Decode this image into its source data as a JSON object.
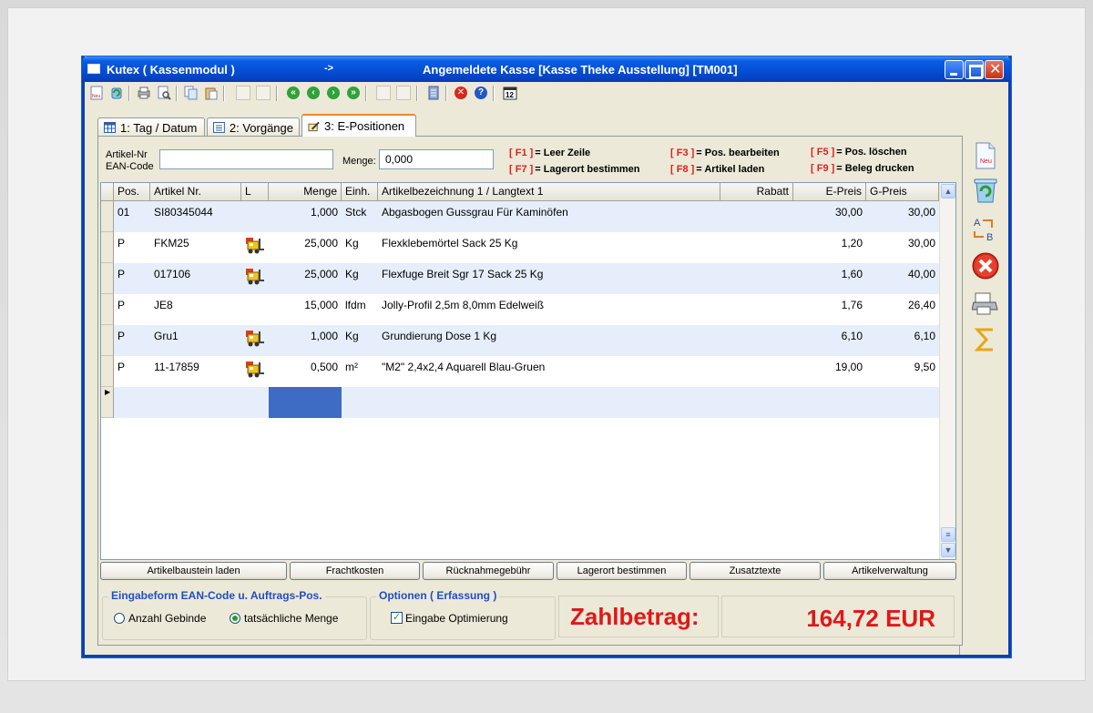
{
  "window": {
    "app_title": "Kutex ( Kassenmodul )",
    "arrow": "->",
    "kasse": "Angemeldete Kasse [Kasse Theke Ausstellung] [TM001]"
  },
  "toolbar": {
    "new_label": "Neu",
    "calendar_label": "12",
    "icons": [
      "new-doc-icon",
      "refresh-icon",
      "print-icon",
      "print-preview-icon",
      "copy-icon",
      "paste-icon",
      "first-icon",
      "prev-icon",
      "next-icon",
      "last-icon",
      "notes-icon",
      "cancel-icon",
      "help-icon",
      "calendar-icon"
    ]
  },
  "tabs": [
    {
      "label": "1: Tag / Datum"
    },
    {
      "label": "2: Vorgänge"
    },
    {
      "label": "3: E-Positionen"
    }
  ],
  "form": {
    "artikel_label_1": "Artikel-Nr",
    "artikel_label_2": "EAN-Code",
    "artikel_value": "",
    "menge_label": "Menge:",
    "menge_value": "0,000"
  },
  "hotkeys": [
    {
      "key": "[ F1 ]",
      "text": "= Leer Zeile"
    },
    {
      "key": "[ F7 ]",
      "text": "= Lagerort bestimmen"
    },
    {
      "key": "[ F3 ]",
      "text": "= Pos. bearbeiten"
    },
    {
      "key": "[ F8 ]",
      "text": "= Artikel laden"
    },
    {
      "key": "[ F5 ]",
      "text": "= Pos. löschen"
    },
    {
      "key": "[ F9 ]",
      "text": "= Beleg drucken"
    }
  ],
  "table": {
    "columns": [
      "Pos.",
      "Artikel Nr.",
      "L",
      "Menge",
      "Einh.",
      "Artikelbezeichnung 1 / Langtext 1",
      "Rabatt",
      "E-Preis",
      "G-Preis"
    ],
    "rows": [
      {
        "pos": "01",
        "artikel": "SI80345044",
        "lager": false,
        "menge": "1,000",
        "einh": "Stck",
        "bez": "Abgasbogen Gussgrau Für Kaminöfen",
        "rabatt": "",
        "epreis": "30,00",
        "gpreis": "30,00"
      },
      {
        "pos": "P",
        "artikel": "FKM25",
        "lager": true,
        "menge": "25,000",
        "einh": "Kg",
        "bez": "Flexklebemörtel Sack 25 Kg",
        "rabatt": "",
        "epreis": "1,20",
        "gpreis": "30,00"
      },
      {
        "pos": "P",
        "artikel": "017106",
        "lager": true,
        "menge": "25,000",
        "einh": "Kg",
        "bez": "Flexfuge Breit Sgr 17 Sack 25 Kg",
        "rabatt": "",
        "epreis": "1,60",
        "gpreis": "40,00"
      },
      {
        "pos": "P",
        "artikel": "JE8",
        "lager": false,
        "menge": "15,000",
        "einh": "lfdm",
        "bez": "Jolly-Profil 2,5m 8,0mm Edelweiß",
        "rabatt": "",
        "epreis": "1,76",
        "gpreis": "26,40"
      },
      {
        "pos": "P",
        "artikel": "Gru1",
        "lager": true,
        "menge": "1,000",
        "einh": "Kg",
        "bez": "Grundierung Dose 1 Kg",
        "rabatt": "",
        "epreis": "6,10",
        "gpreis": "6,10"
      },
      {
        "pos": "P",
        "artikel": "11-17859",
        "lager": true,
        "menge": "0,500",
        "einh": "m²",
        "bez": "\"M2\" 2,4x2,4 Aquarell Blau-Gruen",
        "rabatt": "",
        "epreis": "19,00",
        "gpreis": "9,50"
      }
    ]
  },
  "buttons": [
    "Artikelbaustein laden",
    "Frachtkosten",
    "Rücknahmegebühr",
    "Lagerort bestimmen",
    "Zusatztexte",
    "Artikelverwaltung"
  ],
  "eingabeform": {
    "title": "Eingabeform EAN-Code  u.  Auftrags-Pos.",
    "option1": "Anzahl Gebinde",
    "option2": "tatsächliche Menge",
    "selected": "tatsächliche Menge"
  },
  "optionen": {
    "title": "Optionen ( Erfassung )",
    "checkbox_label": "Eingabe Optimierung",
    "checked": true
  },
  "payment": {
    "label": "Zahlbetrag:",
    "amount": "164,72 EUR"
  },
  "side_icons": [
    "new-doc-icon",
    "recycle-icon",
    "sort-ab-icon",
    "cancel-icon",
    "print-icon",
    "sum-icon"
  ],
  "side_new_label": "Neu",
  "colors": {
    "title_blue": "#0551d8",
    "hotkey_red": "#e02020",
    "amount_red": "#e01818",
    "row_alt": "#e6eefb",
    "selected_cell": "#3e6bc4"
  }
}
